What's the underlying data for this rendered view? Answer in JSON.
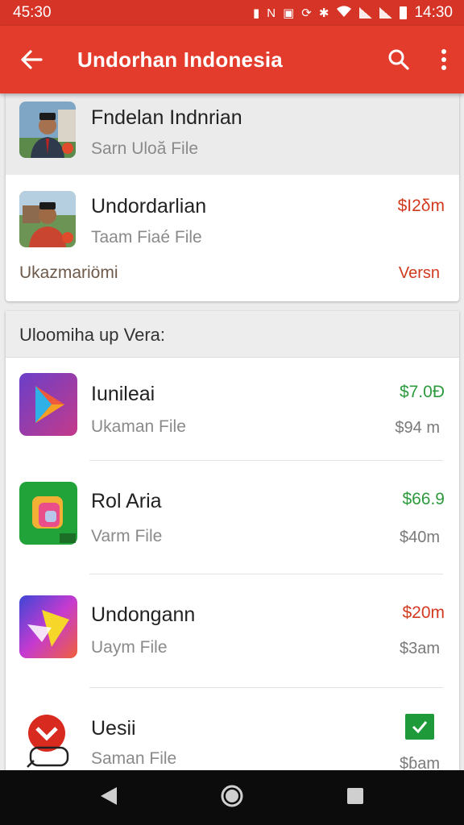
{
  "status_bar": {
    "left_time": "45:30",
    "right_time": "14:30"
  },
  "app_bar": {
    "title": "Undorhan Indonesia"
  },
  "top_items": [
    {
      "title": "Fndelan Indnrian",
      "subtitle": "Sarn Uloă File"
    },
    {
      "title": "Undordarlian",
      "subtitle": "Taam Fiaé File",
      "price": "$I2δm",
      "extra_left": "Ukazmariömi",
      "extra_right": "Versn"
    }
  ],
  "section": {
    "header": "Uloomiha up Vera:",
    "items": [
      {
        "title": "Iunileai",
        "subtitle": "Ukaman File",
        "price": "$7.0Ð",
        "size": "$94 m",
        "price_color": "#2e9a3e",
        "icon": "play-triangle-icon"
      },
      {
        "title": "Rol Aria",
        "subtitle": "Varm File",
        "price": "$66.9",
        "size": "$40m",
        "price_color": "#2e9a3e",
        "icon": "puzzle-app-icon"
      },
      {
        "title": "Undongann",
        "subtitle": "Uaym File",
        "price": "$20m",
        "size": "$3am",
        "price_color": "#d23a1f",
        "icon": "media-play-icon"
      },
      {
        "title": "Uesii",
        "subtitle": "Saman File",
        "size": "$ɓam",
        "icon": "mail-app-icon"
      }
    ]
  },
  "colors": {
    "accent": "#e33b2c",
    "status_bar": "#d63427",
    "green": "#2e9a3e",
    "red": "#d23a1f"
  }
}
